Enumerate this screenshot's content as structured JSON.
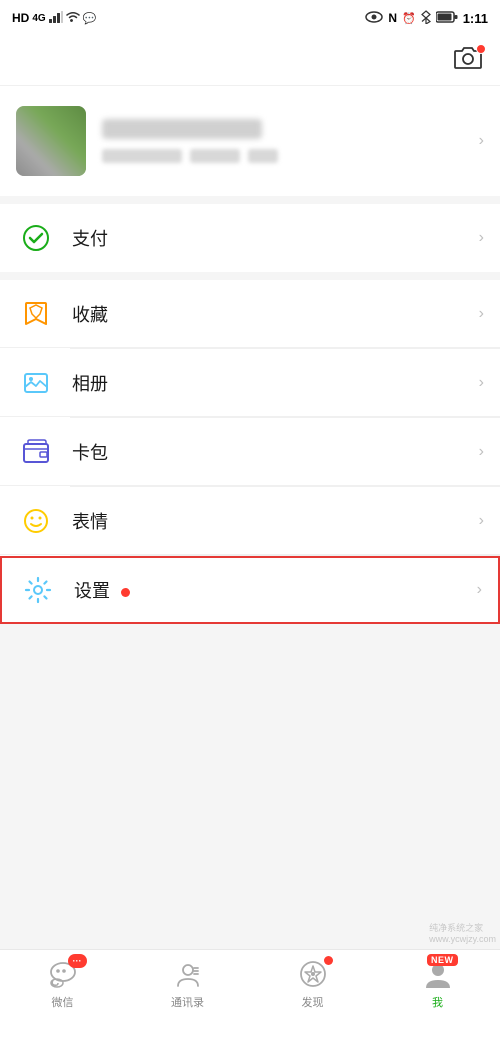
{
  "statusBar": {
    "carrier": "HD",
    "signal": "4G",
    "signal2": "4G",
    "time": "1:11",
    "icons": [
      "eye",
      "nfc",
      "alarm",
      "bluetooth",
      "battery"
    ]
  },
  "header": {
    "cameraLabel": "相机"
  },
  "profile": {
    "nameBlurred": true,
    "subBlurred": true
  },
  "menuItems": [
    {
      "id": "payment",
      "label": "支付",
      "iconType": "payment",
      "highlighted": false
    },
    {
      "id": "favorites",
      "label": "收藏",
      "iconType": "favorites",
      "highlighted": false
    },
    {
      "id": "album",
      "label": "相册",
      "iconType": "album",
      "highlighted": false
    },
    {
      "id": "wallet",
      "label": "卡包",
      "iconType": "wallet",
      "highlighted": false
    },
    {
      "id": "emoji",
      "label": "表情",
      "iconType": "emoji",
      "highlighted": false
    },
    {
      "id": "settings",
      "label": "设置",
      "iconType": "settings",
      "highlighted": true,
      "hasDot": true
    }
  ],
  "bottomNav": [
    {
      "id": "wechat",
      "label": "微信",
      "badge": "···",
      "active": false
    },
    {
      "id": "contacts",
      "label": "通讯录",
      "badge": null,
      "active": false
    },
    {
      "id": "discover",
      "label": "发现",
      "badgeDot": true,
      "active": false
    },
    {
      "id": "me",
      "label": "我",
      "badgeNew": true,
      "active": true
    }
  ],
  "watermark": "纯净系统之家\nwww.ycwjzy.com"
}
